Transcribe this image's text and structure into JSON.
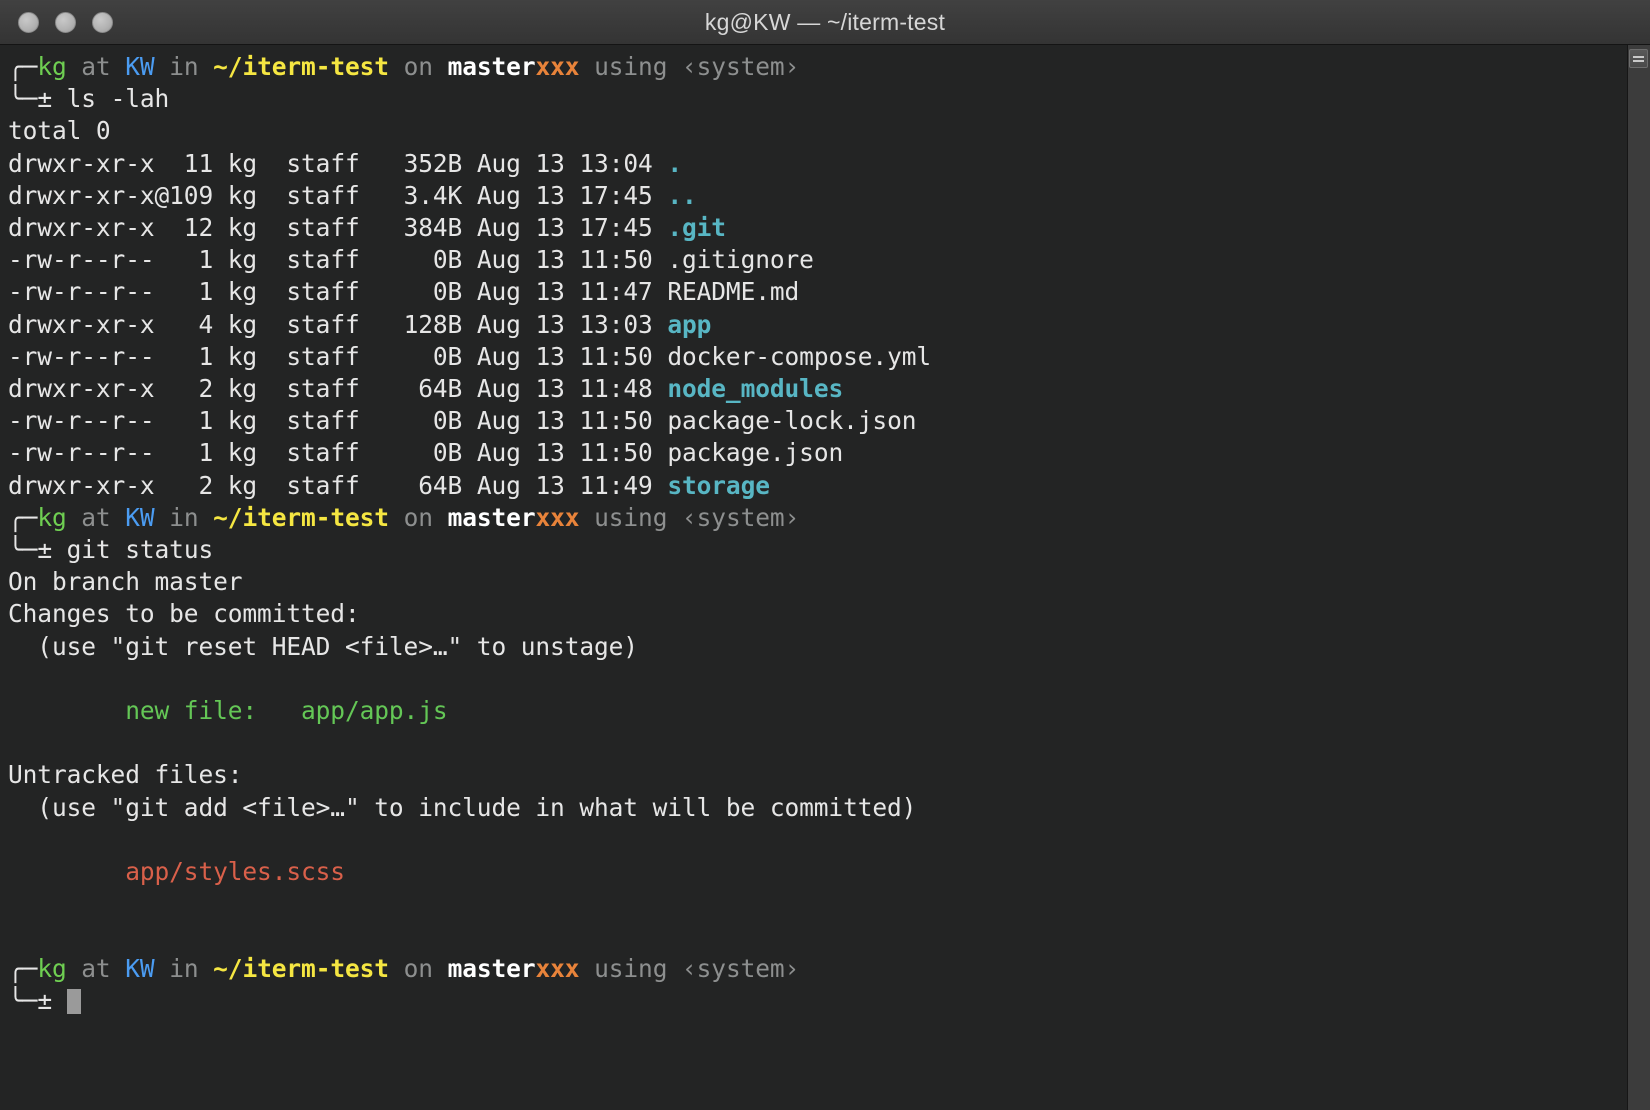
{
  "window": {
    "title": "kg@KW — ~/iterm-test",
    "traffic_lights": [
      "close-button",
      "minimize-button",
      "zoom-button"
    ]
  },
  "scrollbar": {
    "icon": "split-pane-icon"
  },
  "prompt": {
    "top_frame": "╭─",
    "bottom_frame": "╰─",
    "user": "kg",
    "at": " at ",
    "host": "KW",
    "in": " in ",
    "path": "~/iterm-test",
    "on": " on ",
    "branch": "master",
    "dirty": "xxx",
    "using": " using ",
    "toolchain": "‹system›",
    "symbol": "± "
  },
  "commands": {
    "first": "ls -lah",
    "second": "git status"
  },
  "ls_output": {
    "total": "total 0",
    "rows": [
      {
        "perm": "drwxr-xr-x",
        "links": "11",
        "owner": "kg",
        "group": "staff",
        "size": "352B",
        "month": "Aug",
        "day": "13",
        "time": "13:04",
        "name": ".",
        "kind": "dir"
      },
      {
        "perm": "drwxr-xr-x@",
        "links": "109",
        "owner": "kg",
        "group": "staff",
        "size": "3.4K",
        "month": "Aug",
        "day": "13",
        "time": "17:45",
        "name": "..",
        "kind": "dir"
      },
      {
        "perm": "drwxr-xr-x",
        "links": "12",
        "owner": "kg",
        "group": "staff",
        "size": "384B",
        "month": "Aug",
        "day": "13",
        "time": "17:45",
        "name": ".git",
        "kind": "dir"
      },
      {
        "perm": "-rw-r--r--",
        "links": "1",
        "owner": "kg",
        "group": "staff",
        "size": "0B",
        "month": "Aug",
        "day": "13",
        "time": "11:50",
        "name": ".gitignore",
        "kind": "file"
      },
      {
        "perm": "-rw-r--r--",
        "links": "1",
        "owner": "kg",
        "group": "staff",
        "size": "0B",
        "month": "Aug",
        "day": "13",
        "time": "11:47",
        "name": "README.md",
        "kind": "file"
      },
      {
        "perm": "drwxr-xr-x",
        "links": "4",
        "owner": "kg",
        "group": "staff",
        "size": "128B",
        "month": "Aug",
        "day": "13",
        "time": "13:03",
        "name": "app",
        "kind": "dir"
      },
      {
        "perm": "-rw-r--r--",
        "links": "1",
        "owner": "kg",
        "group": "staff",
        "size": "0B",
        "month": "Aug",
        "day": "13",
        "time": "11:50",
        "name": "docker-compose.yml",
        "kind": "file"
      },
      {
        "perm": "drwxr-xr-x",
        "links": "2",
        "owner": "kg",
        "group": "staff",
        "size": "64B",
        "month": "Aug",
        "day": "13",
        "time": "11:48",
        "name": "node_modules",
        "kind": "dir"
      },
      {
        "perm": "-rw-r--r--",
        "links": "1",
        "owner": "kg",
        "group": "staff",
        "size": "0B",
        "month": "Aug",
        "day": "13",
        "time": "11:50",
        "name": "package-lock.json",
        "kind": "file"
      },
      {
        "perm": "-rw-r--r--",
        "links": "1",
        "owner": "kg",
        "group": "staff",
        "size": "0B",
        "month": "Aug",
        "day": "13",
        "time": "11:50",
        "name": "package.json",
        "kind": "file"
      },
      {
        "perm": "drwxr-xr-x",
        "links": "2",
        "owner": "kg",
        "group": "staff",
        "size": "64B",
        "month": "Aug",
        "day": "13",
        "time": "11:49",
        "name": "storage",
        "kind": "dir"
      }
    ]
  },
  "git_status": {
    "branch_line": "On branch master",
    "staged_header": "Changes to be committed:",
    "staged_hint": "  (use \"git reset HEAD <file>…\" to unstage)",
    "staged_entry": "        new file:   app/app.js",
    "untracked_header": "Untracked files:",
    "untracked_hint": "  (use \"git add <file>…\" to include in what will be committed)",
    "untracked_entry": "        app/styles.scss"
  },
  "colors": {
    "background": "#232424",
    "titlebar": "#3a3a3a",
    "foreground": "#e6e6e6",
    "green": "#6fcf52",
    "blue": "#4b9cf2",
    "yellow": "#f5e642",
    "orange": "#e8833a",
    "cyan": "#58b6c4",
    "red": "#d9604a",
    "dim": "#8d8f8f"
  }
}
